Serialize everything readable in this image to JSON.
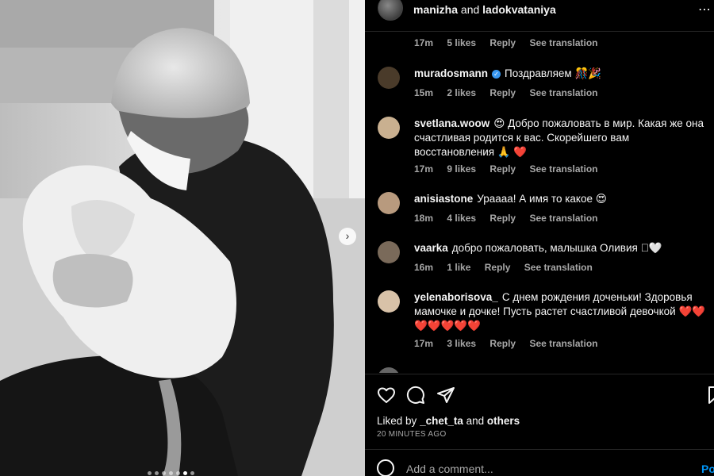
{
  "header": {
    "user1": "manizha",
    "connector": "and",
    "user2": "ladokvataniya",
    "more_icon": "more-horizontal-icon"
  },
  "comments": [
    {
      "meta_only": true,
      "time": "17m",
      "likes": "5 likes",
      "reply": "Reply",
      "translate": "See translation"
    },
    {
      "username": "muradosmann",
      "verified": true,
      "text": "Поздравляем 🎊🎉",
      "time": "15m",
      "likes": "2 likes",
      "reply": "Reply",
      "translate": "See translation",
      "avatar_color": "#4a3b2a"
    },
    {
      "username": "svetlana.woow",
      "text": "😍 Добро пожаловать в мир. Какая же она счастливая родится к вас. Скорейшего вам восстановления 🙏 ❤️",
      "time": "17m",
      "likes": "9 likes",
      "reply": "Reply",
      "translate": "See translation",
      "avatar_color": "#c9b090"
    },
    {
      "username": "anisiastone",
      "text": "Урaааа! А имя то какое 😍",
      "time": "18m",
      "likes": "4 likes",
      "reply": "Reply",
      "translate": "See translation",
      "avatar_color": "#b89a7e"
    },
    {
      "username": "vaarka",
      "text": "добро пожаловать, малышка Оливия 🏼🤍",
      "time": "16m",
      "likes": "1 like",
      "reply": "Reply",
      "translate": "See translation",
      "avatar_color": "#7a6a5a"
    },
    {
      "username": "yelenaborisova_",
      "text": "С днем рождения доченьки! Здоровья мамочке и дочке! Пусть растет счастливой девочкой ❤️❤️❤️❤️❤️❤️❤️",
      "time": "17m",
      "likes": "3 likes",
      "reply": "Reply",
      "translate": "See translation",
      "avatar_color": "#d8c2a8"
    }
  ],
  "actions": {
    "like_icon": "heart-icon",
    "comment_icon": "comment-bubble-icon",
    "share_icon": "paper-plane-icon",
    "save_icon": "bookmark-icon"
  },
  "likes": {
    "prefix": "Liked by",
    "user": "_chet_ta",
    "connector": "and",
    "others": "others"
  },
  "time_ago": "20 MINUTES AGO",
  "add_comment": {
    "placeholder": "Add a comment...",
    "post_label": "Post"
  },
  "carousel": {
    "next_icon": "chevron-right-icon",
    "dot_count": 7,
    "active_index": 5
  },
  "colors": {
    "background": "#000000",
    "secondary_text": "#a8a8a8",
    "link_blue": "#0095f6",
    "verified_blue": "#3897f0"
  }
}
